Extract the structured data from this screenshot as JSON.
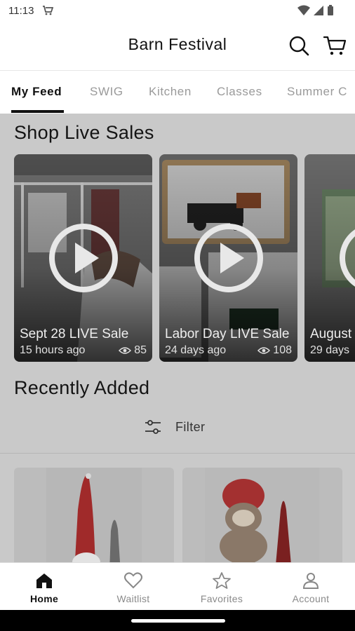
{
  "status_bar": {
    "time": "11:13"
  },
  "app_bar": {
    "title": "Barn Festival"
  },
  "tabs": [
    {
      "label": "My Feed"
    },
    {
      "label": "SWIG"
    },
    {
      "label": "Kitchen"
    },
    {
      "label": "Classes"
    },
    {
      "label": "Summer C"
    }
  ],
  "live_sales": {
    "title": "Shop Live Sales",
    "items": [
      {
        "title": "Sept 28 LIVE Sale",
        "age": "15 hours ago",
        "views": "85"
      },
      {
        "title": "Labor Day LIVE Sale",
        "age": "24 days ago",
        "views": "108"
      },
      {
        "title": "August Sale",
        "age": "29 days"
      }
    ]
  },
  "recently_added": {
    "title": "Recently Added",
    "filter_label": "Filter"
  },
  "bottom_nav": [
    {
      "label": "Home"
    },
    {
      "label": "Waitlist"
    },
    {
      "label": "Favorites"
    },
    {
      "label": "Account"
    }
  ],
  "colors": {
    "overlay": "#c9c9c9",
    "active_text": "#111111",
    "inactive_text": "#9a9a9a"
  }
}
